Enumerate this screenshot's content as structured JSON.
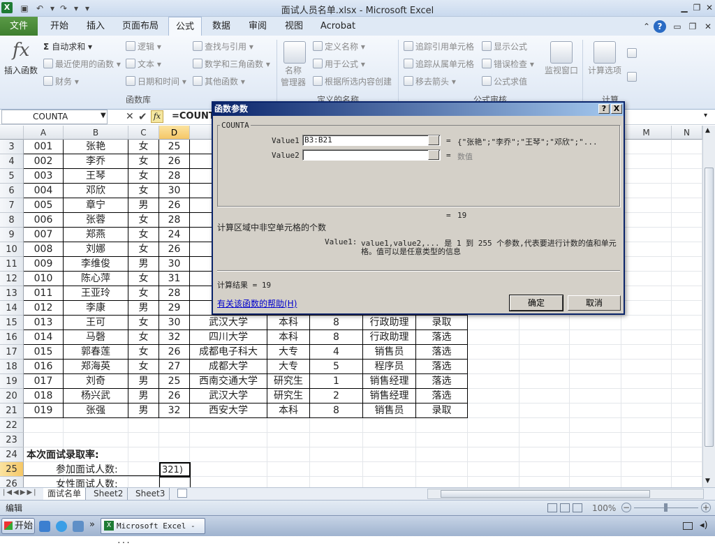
{
  "window": {
    "title": "面试人员名单.xlsx - Microsoft Excel"
  },
  "tabs": [
    {
      "label": "文件"
    },
    {
      "label": "开始"
    },
    {
      "label": "插入"
    },
    {
      "label": "页面布局"
    },
    {
      "label": "公式"
    },
    {
      "label": "数据"
    },
    {
      "label": "审阅"
    },
    {
      "label": "视图"
    },
    {
      "label": "Acrobat"
    }
  ],
  "ribbon": {
    "insert_function": "插入函数",
    "autosum": "自动求和",
    "recent": "最近使用的函数",
    "finance": "财务",
    "logic": "逻辑",
    "text": "文本",
    "datetime": "日期和时间",
    "lookup": "查找与引用",
    "math": "数学和三角函数",
    "other": "其他函数",
    "group_library": "函数库",
    "name_manager_1": "名称",
    "name_manager_2": "管理器",
    "define_name": "定义名称",
    "use_in_formula": "用于公式",
    "create_from_sel": "根据所选内容创建",
    "group_names": "定义的名称",
    "trace_precedents": "追踪引用单元格",
    "trace_dependents": "追踪从属单元格",
    "remove_arrows": "移去箭头",
    "show_formulas": "显示公式",
    "error_check": "错误检查",
    "eval_formula": "公式求值",
    "group_audit": "公式审核",
    "watch_window": "监视窗口",
    "calc_options": "计算选项",
    "group_calc": "计算"
  },
  "formula_bar": {
    "name_box": "COUNTA",
    "fx": "fx",
    "formula": "=COUNT"
  },
  "columns": [
    "A",
    "B",
    "C",
    "D",
    "E",
    "F",
    "G",
    "H",
    "I",
    "J",
    "K",
    "L",
    "M",
    "N"
  ],
  "rows": [
    {
      "n": "3",
      "c": [
        "001",
        "张艳",
        "女",
        "25",
        "",
        "",
        "",
        "",
        ""
      ]
    },
    {
      "n": "4",
      "c": [
        "002",
        "李乔",
        "女",
        "26",
        "",
        "",
        "",
        "",
        ""
      ]
    },
    {
      "n": "5",
      "c": [
        "003",
        "王琴",
        "女",
        "28",
        "西",
        "",
        "",
        "",
        ""
      ]
    },
    {
      "n": "6",
      "c": [
        "004",
        "邓欣",
        "女",
        "30",
        "西",
        "",
        "",
        "",
        ""
      ]
    },
    {
      "n": "7",
      "c": [
        "005",
        "章宁",
        "男",
        "26",
        "",
        "",
        "",
        "",
        ""
      ]
    },
    {
      "n": "8",
      "c": [
        "006",
        "张蓉",
        "女",
        "28",
        "",
        "",
        "",
        "",
        ""
      ]
    },
    {
      "n": "9",
      "c": [
        "007",
        "郑燕",
        "女",
        "24",
        "成",
        "",
        "",
        "",
        ""
      ]
    },
    {
      "n": "10",
      "c": [
        "008",
        "刘娜",
        "女",
        "26",
        "",
        "",
        "",
        "",
        ""
      ]
    },
    {
      "n": "11",
      "c": [
        "009",
        "李维俊",
        "男",
        "30",
        "",
        "",
        "",
        "",
        ""
      ]
    },
    {
      "n": "12",
      "c": [
        "010",
        "陈心萍",
        "女",
        "31",
        "西",
        "",
        "",
        "",
        ""
      ]
    },
    {
      "n": "13",
      "c": [
        "011",
        "王亚玲",
        "女",
        "28",
        "成",
        "",
        "",
        "",
        ""
      ]
    },
    {
      "n": "14",
      "c": [
        "012",
        "李康",
        "男",
        "29",
        "",
        "",
        "",
        "",
        ""
      ]
    },
    {
      "n": "15",
      "c": [
        "013",
        "王可",
        "女",
        "30",
        "武汉大学",
        "本科",
        "8",
        "行政助理",
        "录取"
      ]
    },
    {
      "n": "16",
      "c": [
        "014",
        "马磬",
        "女",
        "32",
        "四川大学",
        "本科",
        "8",
        "行政助理",
        "落选"
      ]
    },
    {
      "n": "17",
      "c": [
        "015",
        "郭春莲",
        "女",
        "26",
        "成都电子科大",
        "大专",
        "4",
        "销售员",
        "落选"
      ]
    },
    {
      "n": "18",
      "c": [
        "016",
        "郑海英",
        "女",
        "27",
        "成都大学",
        "大专",
        "5",
        "程序员",
        "落选"
      ]
    },
    {
      "n": "19",
      "c": [
        "017",
        "刘奇",
        "男",
        "25",
        "西南交通大学",
        "研究生",
        "1",
        "销售经理",
        "落选"
      ]
    },
    {
      "n": "20",
      "c": [
        "018",
        "杨兴武",
        "男",
        "26",
        "武汉大学",
        "研究生",
        "2",
        "销售经理",
        "落选"
      ]
    },
    {
      "n": "21",
      "c": [
        "019",
        "张强",
        "男",
        "32",
        "西安大学",
        "本科",
        "8",
        "销售员",
        "录取"
      ]
    }
  ],
  "extra_rows": [
    {
      "n": "22",
      "label": ""
    },
    {
      "n": "23",
      "label": ""
    },
    {
      "n": "24",
      "label": "本次面试录取率:"
    },
    {
      "n": "25",
      "label": "参加面试人数:",
      "value": "321)"
    },
    {
      "n": "26",
      "label": "女性面试人数:",
      "value": ""
    }
  ],
  "sheets": [
    {
      "label": "面试名单"
    },
    {
      "label": "Sheet2"
    },
    {
      "label": "Sheet3"
    }
  ],
  "status": {
    "mode": "编辑",
    "zoom": "100%"
  },
  "taskbar": {
    "start": "开始",
    "app": "Microsoft Excel - ..."
  },
  "dialog": {
    "title": "函数参数",
    "help_btn": "?",
    "close_btn": "X",
    "func_name": "COUNTA",
    "arg1_label": "Value1",
    "arg1_value": "B3:B21",
    "arg1_result": "{\"张艳\";\"李乔\";\"王琴\";\"邓欣\";\"...",
    "arg2_label": "Value2",
    "arg2_value": "",
    "arg2_result": "数值",
    "eq": "=",
    "func_result": "19",
    "description": "计算区域中非空单元格的个数",
    "param_name": "Value1:",
    "param_desc_1": "value1,value2,... 是 1 到 255 个参数,代表要进行计数的值和单元",
    "param_desc_2": "格。值可以是任意类型的信息",
    "calc_result": "计算结果 = 19",
    "help_link": "有关该函数的帮助(H)",
    "ok": "确定",
    "cancel": "取消"
  }
}
